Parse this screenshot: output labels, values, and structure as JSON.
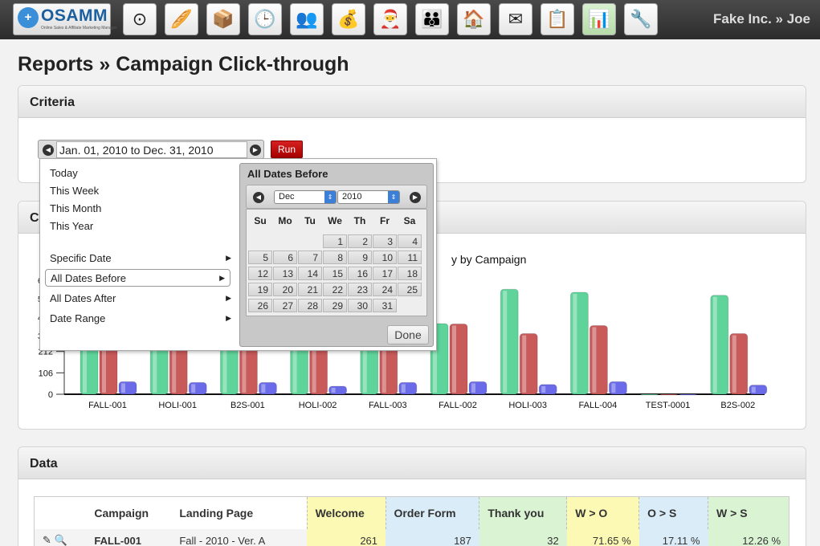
{
  "header": {
    "logo_name": "OSAMM",
    "logo_tagline": "Online Sales & Affiliate Marketing Manager",
    "user": "Fake Inc. » Joe",
    "nav_icons": [
      "dashboard-icon",
      "bread-icon",
      "box-icon",
      "clock-icon",
      "users-icon",
      "money-bag-icon",
      "santa-icon",
      "crowd-icon",
      "house-icon",
      "envelope-icon",
      "clipboard-icon",
      "bar-chart-icon",
      "tools-icon"
    ]
  },
  "page": {
    "title": "Reports » Campaign Click-through"
  },
  "criteria": {
    "heading": "Criteria",
    "date_range": "Jan. 01, 2010 to Dec. 31, 2010",
    "run_label": "Run"
  },
  "date_menu": {
    "quick": [
      "Today",
      "This Week",
      "This Month",
      "This Year"
    ],
    "sub": [
      "Specific Date",
      "All Dates Before",
      "All Dates After",
      "Date Range"
    ],
    "calendar": {
      "title": "All Dates Before",
      "month": "Dec",
      "year": "2010",
      "weekdays": [
        "Su",
        "Mo",
        "Tu",
        "We",
        "Th",
        "Fr",
        "Sa"
      ],
      "days": [
        [
          "",
          "",
          "",
          "1",
          "2",
          "3",
          "4"
        ],
        [
          "5",
          "6",
          "7",
          "8",
          "9",
          "10",
          "11"
        ],
        [
          "12",
          "13",
          "14",
          "15",
          "16",
          "17",
          "18"
        ],
        [
          "19",
          "20",
          "21",
          "22",
          "23",
          "24",
          "25"
        ],
        [
          "26",
          "27",
          "28",
          "29",
          "30",
          "31",
          ""
        ]
      ],
      "done_label": "Done"
    }
  },
  "chart_panel": {
    "heading_visible": "C"
  },
  "chart_data": {
    "type": "bar",
    "title_visible": "y by Campaign",
    "categories": [
      "FALL-001",
      "HOLI-001",
      "B2S-001",
      "HOLI-002",
      "FALL-003",
      "FALL-002",
      "HOLI-003",
      "FALL-004",
      "TEST-0001",
      "B2S-002"
    ],
    "series": [
      {
        "values": [
          530,
          530,
          530,
          530,
          530,
          350,
          520,
          505,
          0,
          490
        ],
        "color": "#5fd49a"
      },
      {
        "values": [
          530,
          530,
          530,
          530,
          530,
          348,
          300,
          340,
          0,
          300
        ],
        "color": "#c85a5a"
      },
      {
        "values": [
          62,
          58,
          58,
          40,
          58,
          62,
          48,
          62,
          0,
          45
        ],
        "color": "#6b6bea"
      }
    ],
    "y_ticks": [
      "0",
      "106",
      "212"
    ],
    "ylim": [
      0,
      640
    ],
    "y_tick_partial": [
      "6",
      "5",
      "4",
      "3"
    ]
  },
  "data_panel": {
    "heading": "Data",
    "columns": [
      "",
      "Campaign",
      "Landing Page",
      "Welcome",
      "Order Form",
      "Thank you",
      "W > O",
      "O > S",
      "W > S"
    ],
    "column_colors": [
      "#fff",
      "#fff",
      "#fff",
      "#fbf9b4",
      "#d9ecf7",
      "#d9f3d3",
      "#fbf9b4",
      "#d9ecf7",
      "#d9f3d3"
    ],
    "rows": [
      [
        "",
        "FALL-001",
        "Fall - 2010 - Ver. A",
        "261",
        "187",
        "32",
        "71.65 %",
        "17.11 %",
        "12.26 %"
      ]
    ]
  }
}
